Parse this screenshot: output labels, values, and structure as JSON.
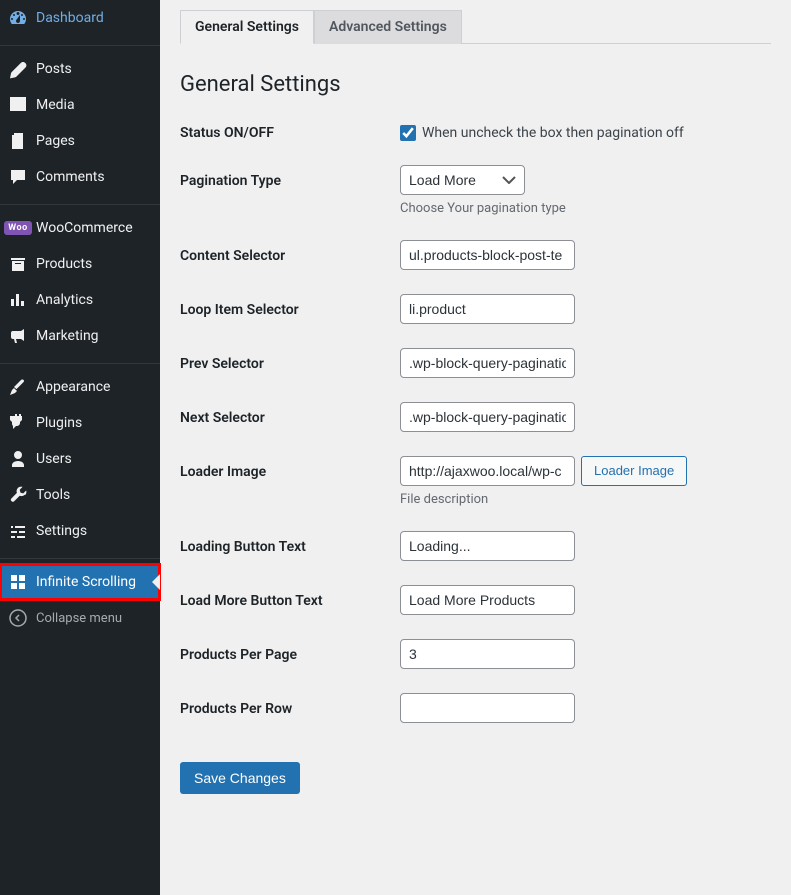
{
  "sidebar": {
    "items": [
      {
        "label": "Dashboard"
      },
      {
        "label": "Posts"
      },
      {
        "label": "Media"
      },
      {
        "label": "Pages"
      },
      {
        "label": "Comments"
      },
      {
        "label": "WooCommerce"
      },
      {
        "label": "Products"
      },
      {
        "label": "Analytics"
      },
      {
        "label": "Marketing"
      },
      {
        "label": "Appearance"
      },
      {
        "label": "Plugins"
      },
      {
        "label": "Users"
      },
      {
        "label": "Tools"
      },
      {
        "label": "Settings"
      },
      {
        "label": "Infinite Scrolling"
      }
    ],
    "collapse": "Collapse menu"
  },
  "tabs": {
    "general": "General Settings",
    "advanced": "Advanced Settings"
  },
  "page_title": "General Settings",
  "form": {
    "status": {
      "label": "Status ON/OFF",
      "text": "When uncheck the box then pagination off"
    },
    "pagination_type": {
      "label": "Pagination Type",
      "value": "Load More",
      "desc": "Choose Your pagination type"
    },
    "content_selector": {
      "label": "Content Selector",
      "value": "ul.products-block-post-te"
    },
    "loop_item": {
      "label": "Loop Item Selector",
      "value": "li.product"
    },
    "prev_selector": {
      "label": "Prev Selector",
      "value": ".wp-block-query-paginatio"
    },
    "next_selector": {
      "label": "Next Selector",
      "value": ".wp-block-query-paginatio"
    },
    "loader_image": {
      "label": "Loader Image",
      "value": "http://ajaxwoo.local/wp-c",
      "button": "Loader Image",
      "desc": "File description"
    },
    "loading_text": {
      "label": "Loading Button Text",
      "value": "Loading..."
    },
    "loadmore_text": {
      "label": "Load More Button Text",
      "value": "Load More Products"
    },
    "per_page": {
      "label": "Products Per Page",
      "value": "3"
    },
    "per_row": {
      "label": "Products Per Row",
      "value": ""
    },
    "submit": "Save Changes"
  }
}
